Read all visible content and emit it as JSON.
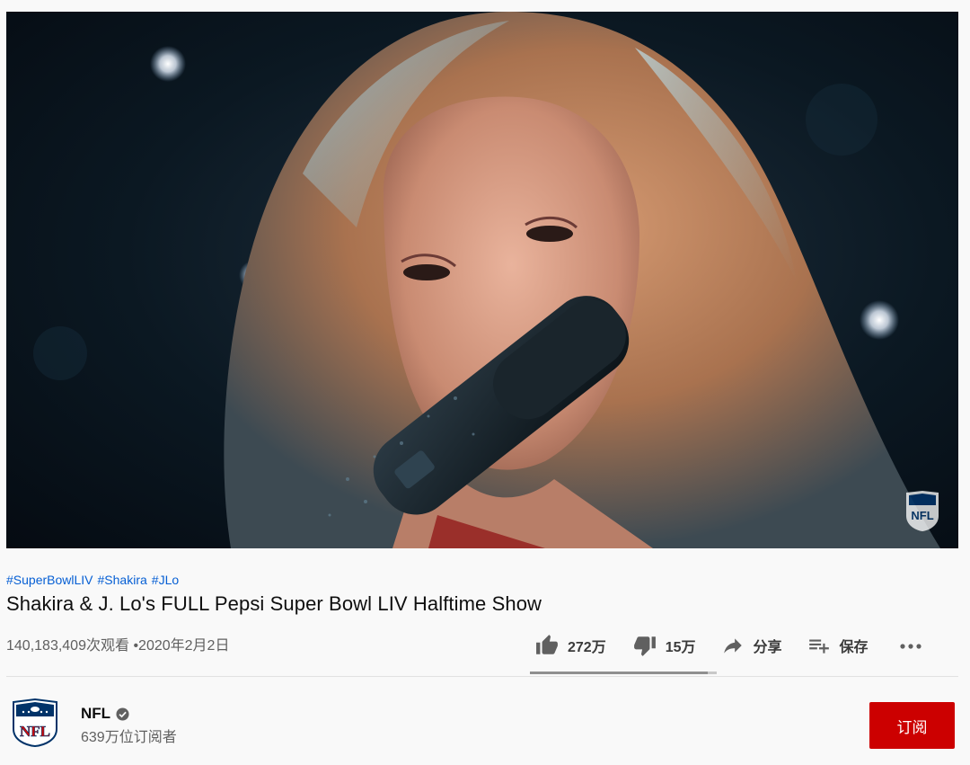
{
  "video": {
    "hashtags": [
      "#SuperBowlLIV",
      "#Shakira",
      "#JLo"
    ],
    "title": "Shakira & J. Lo's FULL Pepsi Super Bowl LIV Halftime Show",
    "views": "140,183,409次观看",
    "separator": "•",
    "date": "2020年2月2日"
  },
  "actions": {
    "likes": "272万",
    "dislikes": "15万",
    "share_label": "分享",
    "save_label": "保存"
  },
  "sentiment_like_fraction": 0.95,
  "channel": {
    "name": "NFL",
    "subscribers": "639万位订阅者",
    "subscribe_label": "订阅"
  },
  "icons": {
    "like": "thumbs-up-icon",
    "dislike": "thumbs-down-icon",
    "share": "share-arrow-icon",
    "save": "playlist-add-icon",
    "more": "more-horizontal-icon",
    "verified": "verified-check-icon"
  },
  "colors": {
    "accent_link": "#065fd4",
    "subscribe": "#cc0000",
    "nfl_blue": "#013369",
    "nfl_red": "#d50a0a"
  }
}
